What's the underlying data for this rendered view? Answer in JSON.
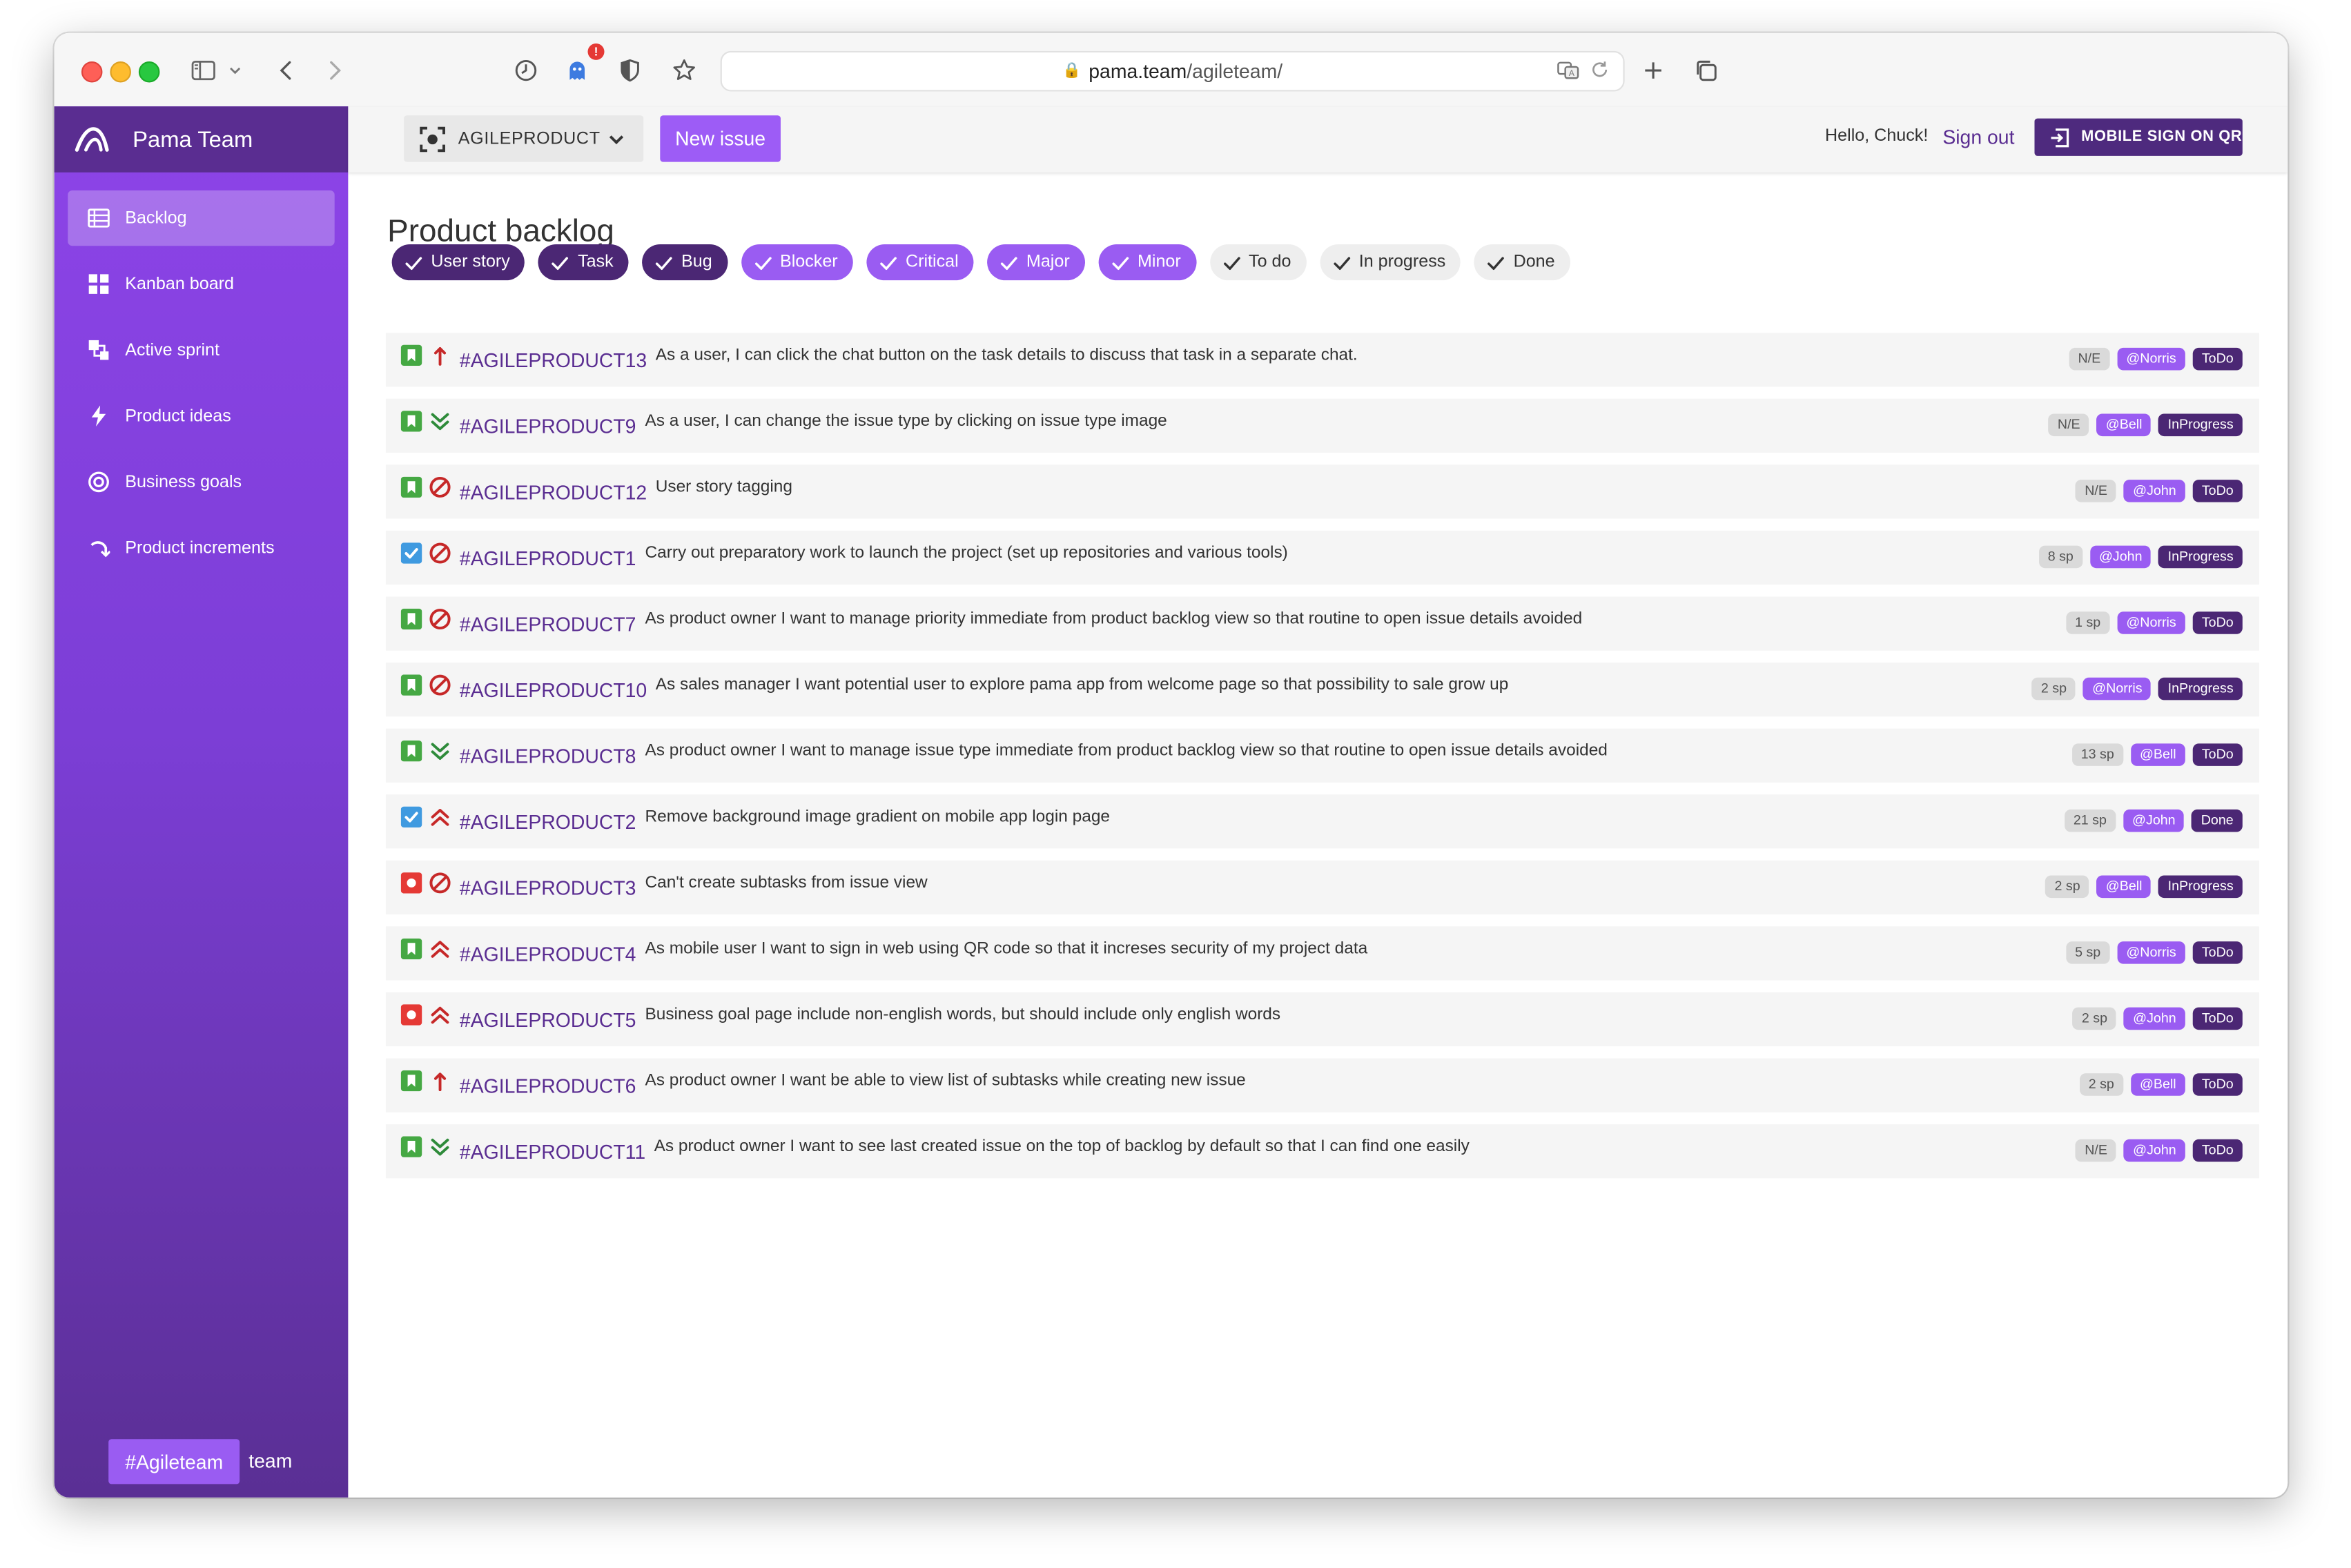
{
  "browser": {
    "url_host": "pama.team",
    "url_path": "/agileteam/",
    "extension_badge": "!"
  },
  "sidebar": {
    "brand": "Pama Team",
    "items": [
      {
        "label": "Backlog",
        "icon": "list-icon",
        "active": true
      },
      {
        "label": "Kanban board",
        "icon": "grid-icon"
      },
      {
        "label": "Active sprint",
        "icon": "sprint-icon"
      },
      {
        "label": "Product ideas",
        "icon": "bolt-icon"
      },
      {
        "label": "Business goals",
        "icon": "target-icon"
      },
      {
        "label": "Product increments",
        "icon": "redo-icon"
      }
    ],
    "team_tag": "#Agileteam",
    "team_suffix": "team"
  },
  "topbar": {
    "project": "AGILEPRODUCT",
    "new_issue": "New issue",
    "greeting": "Hello, Chuck!",
    "sign_out": "Sign out",
    "qr_button": "MOBILE SIGN ON QR"
  },
  "main": {
    "title": "Product backlog",
    "filters": [
      {
        "label": "User story",
        "style": "dark"
      },
      {
        "label": "Task",
        "style": "dark"
      },
      {
        "label": "Bug",
        "style": "dark"
      },
      {
        "label": "Blocker",
        "style": "light"
      },
      {
        "label": "Critical",
        "style": "light"
      },
      {
        "label": "Major",
        "style": "light"
      },
      {
        "label": "Minor",
        "style": "light"
      },
      {
        "label": "To do",
        "style": "grey"
      },
      {
        "label": "In progress",
        "style": "grey"
      },
      {
        "label": "Done",
        "style": "grey"
      }
    ],
    "issues": [
      {
        "type": "story",
        "priority": "critical",
        "key": "#AGILEPRODUCT13",
        "summary": "As a user, I can click the chat button on the task details to discuss that task in a separate chat.",
        "estimate": "N/E",
        "assignee": "@Norris",
        "status": "ToDo"
      },
      {
        "type": "story",
        "priority": "minor",
        "key": "#AGILEPRODUCT9",
        "summary": "As a user, I can change the issue type by clicking on issue type image",
        "estimate": "N/E",
        "assignee": "@Bell",
        "status": "InProgress"
      },
      {
        "type": "story",
        "priority": "blocker",
        "key": "#AGILEPRODUCT12",
        "summary": "User story tagging",
        "estimate": "N/E",
        "assignee": "@John",
        "status": "ToDo"
      },
      {
        "type": "task",
        "priority": "blocker",
        "key": "#AGILEPRODUCT1",
        "summary": "Carry out preparatory work to launch the project (set up repositories and various tools)",
        "estimate": "8 sp",
        "assignee": "@John",
        "status": "InProgress"
      },
      {
        "type": "story",
        "priority": "blocker",
        "key": "#AGILEPRODUCT7",
        "summary": "As product owner I want to manage priority immediate from product backlog view so that routine to open issue details avoided",
        "estimate": "1 sp",
        "assignee": "@Norris",
        "status": "ToDo"
      },
      {
        "type": "story",
        "priority": "blocker",
        "key": "#AGILEPRODUCT10",
        "summary": "As sales manager I want potential user to explore pama app from welcome page so that possibility to sale grow up",
        "estimate": "2 sp",
        "assignee": "@Norris",
        "status": "InProgress"
      },
      {
        "type": "story",
        "priority": "minor",
        "key": "#AGILEPRODUCT8",
        "summary": "As product owner I want to manage issue type immediate from product backlog view so that routine to open issue details avoided",
        "estimate": "13 sp",
        "assignee": "@Bell",
        "status": "ToDo"
      },
      {
        "type": "task",
        "priority": "major",
        "key": "#AGILEPRODUCT2",
        "summary": "Remove background image gradient on mobile app login page",
        "estimate": "21 sp",
        "assignee": "@John",
        "status": "Done"
      },
      {
        "type": "bug",
        "priority": "blocker",
        "key": "#AGILEPRODUCT3",
        "summary": "Can't create subtasks from issue view",
        "estimate": "2 sp",
        "assignee": "@Bell",
        "status": "InProgress"
      },
      {
        "type": "story",
        "priority": "major",
        "key": "#AGILEPRODUCT4",
        "summary": "As mobile user I want to sign in web using QR code so that it increses security of my project data",
        "estimate": "5 sp",
        "assignee": "@Norris",
        "status": "ToDo"
      },
      {
        "type": "bug",
        "priority": "major",
        "key": "#AGILEPRODUCT5",
        "summary": "Business goal page include non-english words, but should include only english words",
        "estimate": "2 sp",
        "assignee": "@John",
        "status": "ToDo"
      },
      {
        "type": "story",
        "priority": "critical",
        "key": "#AGILEPRODUCT6",
        "summary": "As product owner I want be able to view list of subtasks while creating new issue",
        "estimate": "2 sp",
        "assignee": "@Bell",
        "status": "ToDo"
      },
      {
        "type": "story",
        "priority": "minor",
        "key": "#AGILEPRODUCT11",
        "summary": "As product owner I want to see last created issue on the top of backlog by default so that I can find one easily",
        "estimate": "N/E",
        "assignee": "@John",
        "status": "ToDo"
      }
    ]
  },
  "colors": {
    "accent": "#9a5cf2",
    "dark_purple": "#4b2774",
    "story_green": "#45a843",
    "task_blue": "#3f9ae0",
    "bug_red": "#e53935",
    "priority_red": "#c62828",
    "priority_green": "#2e8b3a"
  }
}
